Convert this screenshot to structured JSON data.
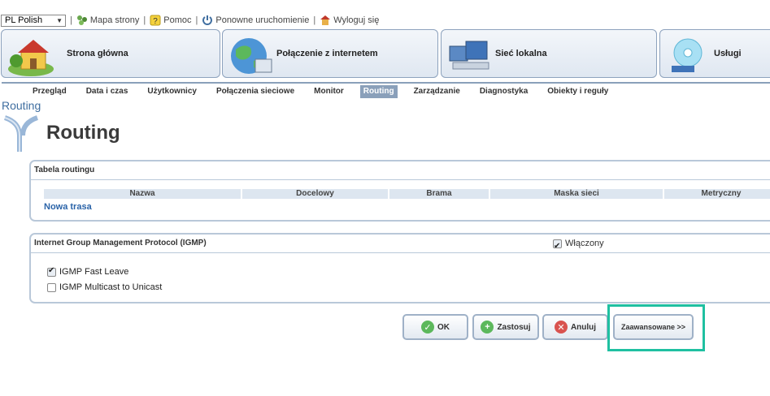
{
  "topbar": {
    "language": "PL Polish",
    "links": [
      {
        "label": "Mapa strony",
        "icon": "sitemap-icon"
      },
      {
        "label": "Pomoc",
        "icon": "help-icon"
      },
      {
        "label": "Ponowne uruchomienie",
        "icon": "power-icon"
      },
      {
        "label": "Wyloguj się",
        "icon": "logout-icon"
      }
    ]
  },
  "tiles": [
    {
      "label": "Strona główna",
      "icon": "house-icon"
    },
    {
      "label": "Połączenie z internetem",
      "icon": "globe-icon"
    },
    {
      "label": "Sieć lokalna",
      "icon": "computers-icon"
    },
    {
      "label": "Usługi",
      "icon": "disc-icon"
    }
  ],
  "subnav": [
    "Przegląd",
    "Data i czas",
    "Użytkownicy",
    "Połączenia sieciowe",
    "Monitor",
    "Routing",
    "Zarządzanie",
    "Diagnostyka",
    "Obiekty i reguły"
  ],
  "subnav_active": "Routing",
  "breadcrumb": "Routing",
  "page_title": "Routing",
  "routing_table": {
    "title": "Tabela routingu",
    "columns": [
      "Nazwa",
      "Docelowy",
      "Brama",
      "Maska sieci",
      "Metryczny"
    ],
    "new_route": "Nowa trasa"
  },
  "igmp": {
    "title": "Internet Group Management Protocol (IGMP)",
    "enabled_label": "Włączony",
    "enabled": true,
    "options": [
      {
        "label": "IGMP Fast Leave",
        "checked": true
      },
      {
        "label": "IGMP Multicast to Unicast",
        "checked": false
      }
    ]
  },
  "buttons": {
    "ok": "OK",
    "apply": "Zastosuj",
    "cancel": "Anuluj",
    "advanced": "Zaawansowane >>"
  },
  "colors": {
    "accent": "#8aa0ba",
    "link": "#2a63a8",
    "highlight": "#1fc0a1"
  }
}
